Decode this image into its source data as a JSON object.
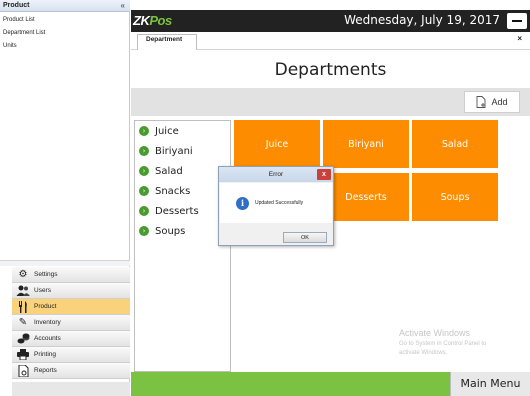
{
  "sidebar": {
    "header": "Product",
    "collapse_glyph": "«",
    "items": [
      {
        "label": "Product List"
      },
      {
        "label": "Department List"
      },
      {
        "label": "Units"
      }
    ],
    "nav": [
      {
        "label": "Settings",
        "icon": "gear-icon"
      },
      {
        "label": "Users",
        "icon": "users-icon"
      },
      {
        "label": "Product",
        "icon": "fork-knife-icon",
        "active": true
      },
      {
        "label": "Inventory",
        "icon": "pencil-icon"
      },
      {
        "label": "Accounts",
        "icon": "coins-icon"
      },
      {
        "label": "Printing",
        "icon": "printer-icon"
      },
      {
        "label": "Reports",
        "icon": "report-icon"
      }
    ]
  },
  "topbar": {
    "logo_zk": "ZK",
    "logo_pos": "Pos",
    "datetime": "Wednesday, July 19, 2017"
  },
  "tabs": {
    "active_label": "Department",
    "close_glyph": "×"
  },
  "page": {
    "title": "Departments",
    "add_label": "Add"
  },
  "departments": [
    {
      "name": "Juice"
    },
    {
      "name": "Biriyani"
    },
    {
      "name": "Salad"
    },
    {
      "name": "Snacks"
    },
    {
      "name": "Desserts"
    },
    {
      "name": "Soups"
    }
  ],
  "tiles": [
    {
      "name": "Juice"
    },
    {
      "name": "Biriyani"
    },
    {
      "name": "Salad"
    },
    {
      "name": ""
    },
    {
      "name": "Desserts"
    },
    {
      "name": "Soups"
    }
  ],
  "dialog": {
    "title": "Error",
    "close_glyph": "x",
    "message": "Updated Successfully",
    "ok_label": "OK",
    "icon_glyph": "i"
  },
  "watermark": {
    "line1": "Activate Windows",
    "line2": "Go to System in Control Panel to",
    "line3": "activate Windows."
  },
  "bottombar": {
    "main_menu_label": "Main Menu"
  },
  "colors": {
    "tile": "#fe8c00",
    "bottom_bar": "#7bc242",
    "top_bar": "#222222",
    "active_nav": "#fad27c"
  }
}
